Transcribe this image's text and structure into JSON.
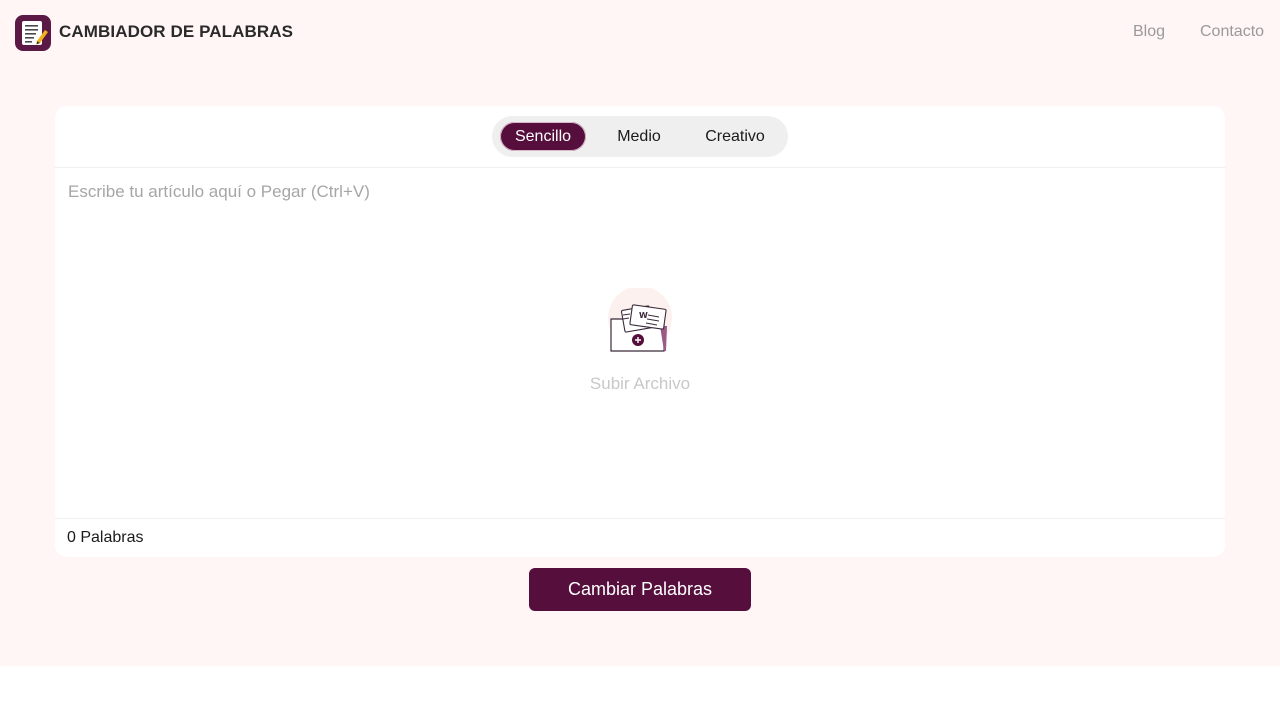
{
  "header": {
    "brand": "CAMBIADOR DE PALABRAS",
    "logo_icon": "notepad-pencil-icon",
    "nav": [
      {
        "label": "Blog"
      },
      {
        "label": "Contacto"
      }
    ]
  },
  "modes": {
    "tabs": [
      {
        "label": "Sencillo",
        "selected": true
      },
      {
        "label": "Medio",
        "selected": false
      },
      {
        "label": "Creativo",
        "selected": false
      }
    ]
  },
  "editor": {
    "placeholder": "Escribe tu artículo aquí o Pegar (Ctrl+V)",
    "value": "",
    "upload_icon": "folder-documents-upload-icon",
    "upload_label": "Subir Archivo"
  },
  "footer": {
    "word_count": "0 Palabras"
  },
  "actions": {
    "submit_label": "Cambiar Palabras"
  },
  "colors": {
    "accent": "#560e3c",
    "background": "#fff6f5",
    "card": "#ffffff"
  }
}
